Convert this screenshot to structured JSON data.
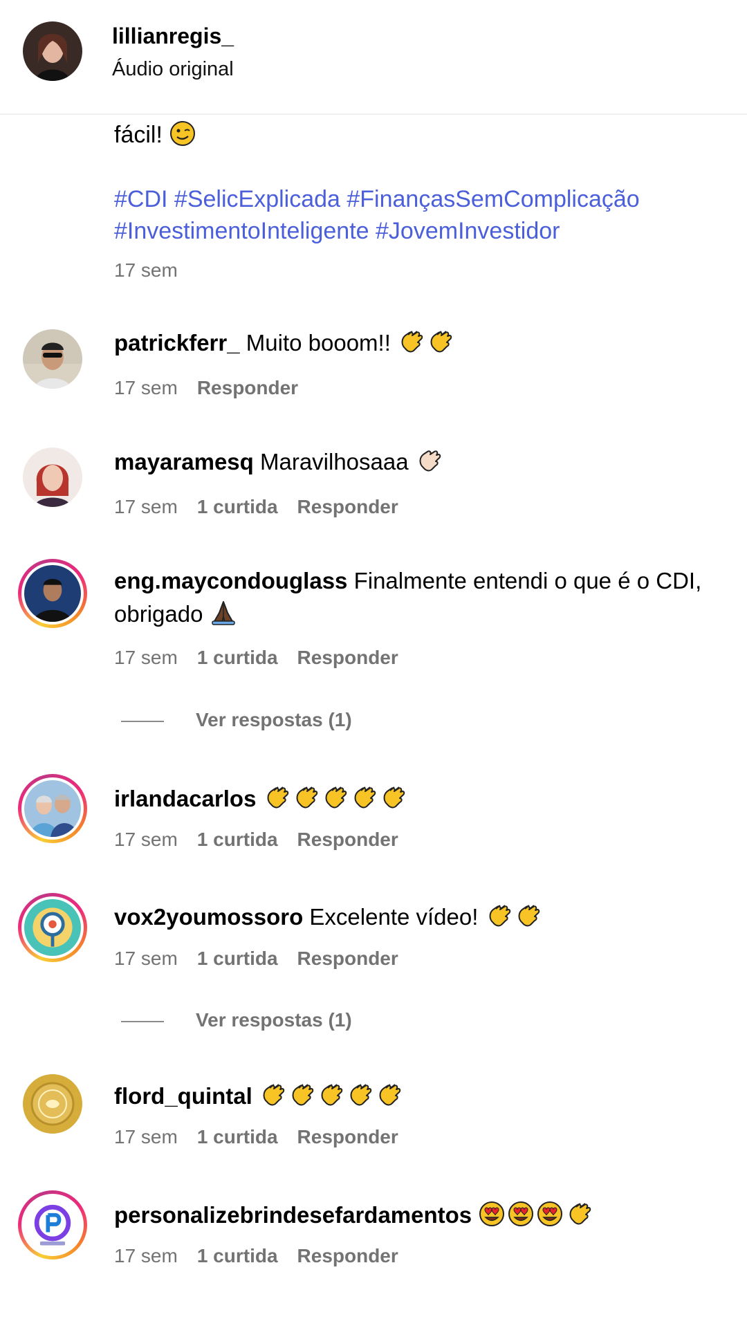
{
  "header": {
    "username": "lillianregis_",
    "audio": "Áudio original"
  },
  "caption": {
    "text": "fácil!",
    "hashtags_line1": "#CDI #SelicExplicada #FinançasSemComplicação",
    "hashtags_line2": "#InvestimentoInteligente #JovemInvestidor",
    "time": "17 sem"
  },
  "comments": [
    {
      "user": "patrickferr_",
      "text": "Muito booom!!",
      "time": "17 sem",
      "likes": "",
      "reply": "Responder"
    },
    {
      "user": "mayaramesq",
      "text": "Maravilhosaaa",
      "time": "17 sem",
      "likes": "1 curtida",
      "reply": "Responder"
    },
    {
      "user": "eng.maycondouglass",
      "text": "Finalmente entendi o que é o CDI,",
      "text2": "obrigado",
      "time": "17 sem",
      "likes": "1 curtida",
      "reply": "Responder",
      "view_replies": "Ver respostas (1)"
    },
    {
      "user": "irlandacarlos",
      "text": "",
      "time": "17 sem",
      "likes": "1 curtida",
      "reply": "Responder"
    },
    {
      "user": "vox2youmossoro",
      "text": "Excelente vídeo!",
      "time": "17 sem",
      "likes": "1 curtida",
      "reply": "Responder",
      "view_replies": "Ver respostas (1)"
    },
    {
      "user": "flord_quintal",
      "text": "",
      "time": "17 sem",
      "likes": "1 curtida",
      "reply": "Responder"
    },
    {
      "user": "personalizebrindesefardamentos",
      "text": "",
      "time": "17 sem",
      "likes": "1 curtida",
      "reply": "Responder"
    }
  ],
  "colors": {
    "hashtag": "#4a5fd9",
    "meta": "#737373"
  },
  "icons": [
    "wink-emoji",
    "clap-emoji",
    "pray-emoji",
    "heart-eyes-emoji"
  ]
}
